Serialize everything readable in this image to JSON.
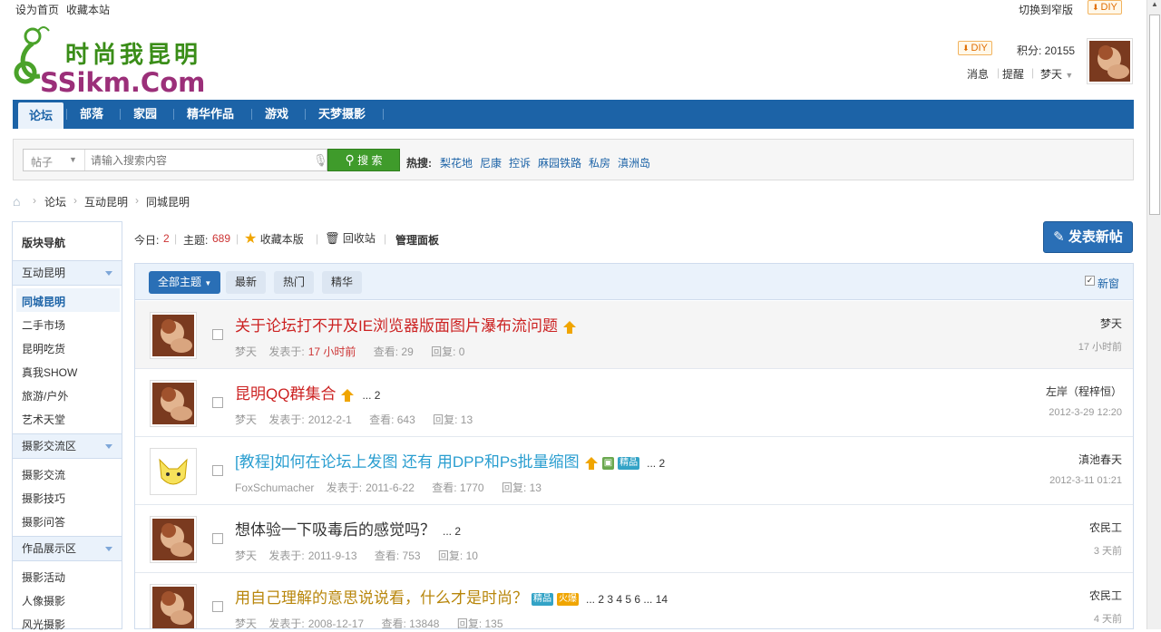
{
  "topbar": {
    "set_home": "设为首页",
    "favorite": "收藏本站",
    "narrow": "切换到窄版",
    "diy": "DIY"
  },
  "logo": {
    "cn": "时尚我昆明",
    "en": "SSikm.Com"
  },
  "user": {
    "diy": "DIY",
    "points_label": "积分: 20155",
    "msg": "消息",
    "remind": "提醒",
    "name": "梦天"
  },
  "nav": [
    "论坛",
    "部落",
    "家园",
    "精华作品",
    "游戏",
    "天梦摄影"
  ],
  "search": {
    "type": "帖子",
    "placeholder": "请输入搜索内容",
    "button": "搜 索",
    "hot_label": "热搜:",
    "hot": [
      "梨花地",
      "尼康",
      "控诉",
      "麻园铁路",
      "私房",
      "滇洲岛"
    ]
  },
  "breadcrumb": [
    "论坛",
    "互动昆明",
    "同城昆明"
  ],
  "sidebar": {
    "title": "版块导航",
    "groups": [
      {
        "name": "互动昆明",
        "items": [
          "同城昆明",
          "二手市场",
          "昆明吃货",
          "真我SHOW",
          "旅游/户外",
          "艺术天堂"
        ]
      },
      {
        "name": "摄影交流区",
        "items": [
          "摄影交流",
          "摄影技巧",
          "摄影问答"
        ]
      },
      {
        "name": "作品展示区",
        "items": [
          "摄影活动",
          "人像摄影",
          "风光摄影"
        ]
      }
    ]
  },
  "stats": {
    "today_label": "今日:",
    "today": "2",
    "topics_label": "主题:",
    "topics": "689",
    "fav": "收藏本版",
    "recycle": "回收站",
    "manage": "管理面板"
  },
  "post_button": "发表新帖",
  "tabs": [
    "全部主题",
    "最新",
    "热门",
    "精华"
  ],
  "newwin": "新窗",
  "threads": [
    {
      "title": "关于论坛打不开及IE浏览器版面图片瀑布流问题",
      "color": "#cc2222",
      "author": "梦天",
      "posted": "发表于:",
      "date": "17 小时前",
      "views": "查看: 29",
      "replies": "回复: 0",
      "last_user": "梦天",
      "last_time": "17 小时前",
      "pages": ""
    },
    {
      "title": "昆明QQ群集合",
      "color": "#cc2222",
      "author": "梦天",
      "posted": "发表于:",
      "date": "2012-2-1",
      "views": "查看: 643",
      "replies": "回复: 13",
      "last_user": "左岸（程梓恒）",
      "last_time": "2012-3-29 12:20",
      "pages": "... 2"
    },
    {
      "title": "[教程]如何在论坛上发图 还有 用DPP和Ps批量缩图",
      "color": "#2a9ed0",
      "author": "FoxSchumacher",
      "posted": "发表于:",
      "date": "2011-6-22",
      "views": "查看: 1770",
      "replies": "回复: 13",
      "last_user": "滇池春天",
      "last_time": "2012-3-11 01:21",
      "pages": "... 2"
    },
    {
      "title": "想体验一下吸毒后的感觉吗？",
      "color": "#333333",
      "author": "梦天",
      "posted": "发表于:",
      "date": "2011-9-13",
      "views": "查看: 753",
      "replies": "回复: 10",
      "last_user": "农民工",
      "last_time": "3 天前",
      "pages": "... 2"
    },
    {
      "title": "用自己理解的意思说说看，什么才是时尚？",
      "color": "#b8860b",
      "author": "梦天",
      "posted": "发表于:",
      "date": "2008-12-17",
      "views": "查看: 13848",
      "replies": "回复: 135",
      "last_user": "农民工",
      "last_time": "4 天前",
      "pages": "... 2  3  4  5  6 ... 14"
    }
  ],
  "badges": {
    "jing": "精品",
    "huo": "火爆"
  },
  "colors": {
    "nav": "#1c63a7",
    "accent": "#2a6fb6",
    "search_btn": "#3f9b2b"
  }
}
